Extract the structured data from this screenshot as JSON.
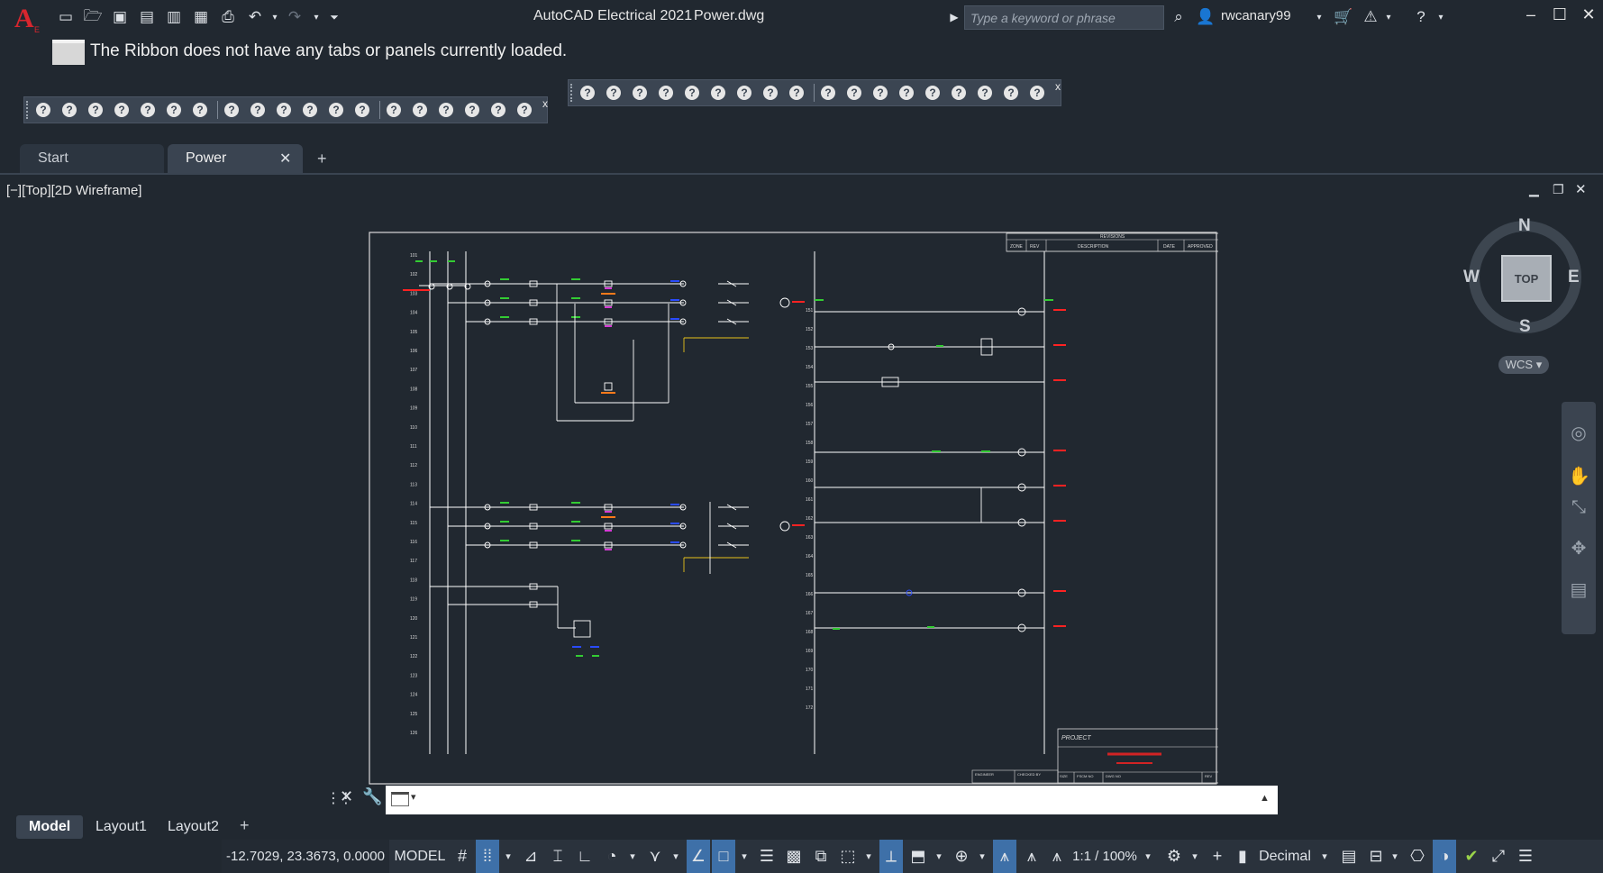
{
  "app": {
    "title": "AutoCAD Electrical 2021",
    "filename": "Power.dwg",
    "logo": "A",
    "logo_sub": "E",
    "search_placeholder": "Type a keyword or phrase",
    "user": "rwcanary99"
  },
  "ribbon": {
    "message": "The Ribbon does not have any tabs or panels currently loaded."
  },
  "toolbars": {
    "left_count": 19,
    "right_count": 18,
    "glyph": "?",
    "close": "x"
  },
  "doc_tabs": [
    {
      "label": "Start",
      "active": false
    },
    {
      "label": "Power",
      "active": true,
      "close": "✕"
    }
  ],
  "new_tab": "+",
  "viewport": {
    "label": "[−][Top][2D Wireframe]"
  },
  "viewcube": {
    "n": "N",
    "s": "S",
    "e": "E",
    "w": "W",
    "top": "TOP",
    "wcs": "WCS ▾"
  },
  "drawing": {
    "title_block": {
      "revisions": "REVISIONS",
      "zone": "ZONE",
      "rev": "REV",
      "description": "DESCRIPTION",
      "date": "DATE",
      "approved": "APPROVED",
      "project": "PROJECT",
      "engineer": "ENGINEER",
      "checked_by": "CHECKED BY",
      "size": "SIZE",
      "fscm": "FSCM NO",
      "dwg": "DWG NO",
      "rev2": "REV"
    },
    "left_rungs": [
      "101",
      "102",
      "103",
      "104",
      "105",
      "106",
      "107",
      "108",
      "109",
      "110",
      "111",
      "112",
      "113",
      "114",
      "115",
      "116",
      "117",
      "118",
      "119",
      "120",
      "121",
      "122",
      "123",
      "124",
      "125",
      "126"
    ],
    "right_rungs": [
      "151",
      "152",
      "153",
      "154",
      "155",
      "156",
      "157",
      "158",
      "159",
      "160",
      "161",
      "162",
      "163",
      "164",
      "165",
      "166",
      "167",
      "168",
      "169",
      "170",
      "171",
      "172"
    ]
  },
  "layout_tabs": [
    {
      "label": "Model",
      "active": true
    },
    {
      "label": "Layout1",
      "active": false
    },
    {
      "label": "Layout2",
      "active": false
    }
  ],
  "status": {
    "coords": "-12.7029, 23.3673, 0.0000",
    "model": "MODEL",
    "scale": "1:1 / 100%",
    "units": "Decimal"
  },
  "colors": {
    "background": "#212830",
    "canvas": "#212830",
    "wire": "#ffffff",
    "green": "#33cc33",
    "blue": "#2a4bff",
    "red": "#ff2222",
    "magenta": "#d63bd6",
    "orange": "#ff7a1a",
    "yellow": "#e8c21a"
  }
}
